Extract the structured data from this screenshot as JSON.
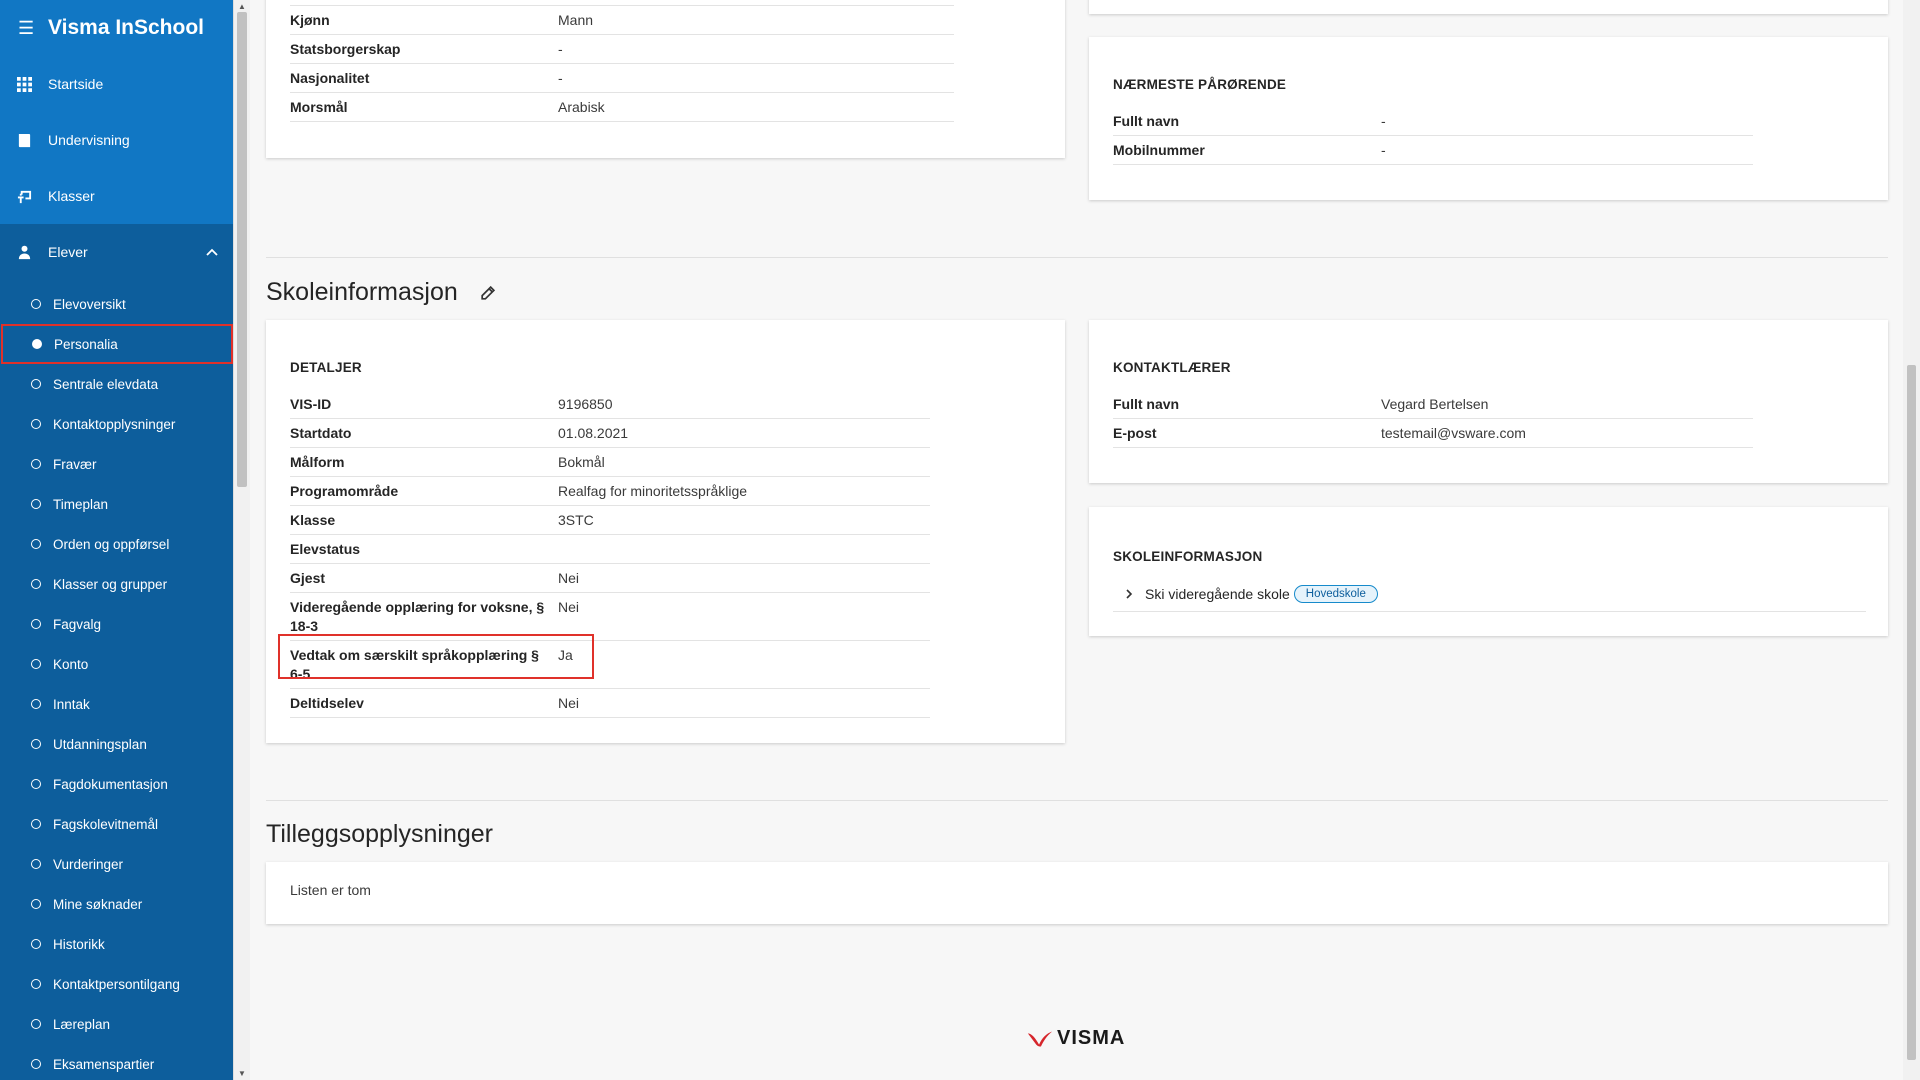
{
  "app": {
    "title": "Visma InSchool",
    "footer_logo": "VISMA"
  },
  "sidebar": {
    "main": [
      {
        "label": "Startside",
        "icon": "grid-icon"
      },
      {
        "label": "Undervisning",
        "icon": "book-icon"
      },
      {
        "label": "Klasser",
        "icon": "classroom-icon"
      },
      {
        "label": "Elever",
        "icon": "student-icon"
      }
    ],
    "sub": [
      "Elevoversikt",
      "Personalia",
      "Sentrale elevdata",
      "Kontaktopplysninger",
      "Fravær",
      "Timeplan",
      "Orden og oppførsel",
      "Klasser og grupper",
      "Fagvalg",
      "Konto",
      "Inntak",
      "Utdanningsplan",
      "Fagdokumentasjon",
      "Fagskolevitnemål",
      "Vurderinger",
      "Mine søknader",
      "Historikk",
      "Kontaktpersontilgang",
      "Læreplan",
      "Eksamenspartier"
    ]
  },
  "personal": {
    "rows": [
      {
        "k": "Kjønn",
        "v": "Mann"
      },
      {
        "k": "Statsborgerskap",
        "v": "-"
      },
      {
        "k": "Nasjonalitet",
        "v": "-"
      },
      {
        "k": "Morsmål",
        "v": "Arabisk"
      }
    ]
  },
  "relative": {
    "title": "NÆRMESTE PÅRØRENDE",
    "rows": [
      {
        "k": "Fullt navn",
        "v": "-"
      },
      {
        "k": "Mobilnummer",
        "v": "-"
      }
    ]
  },
  "school_section": {
    "title": "Skoleinformasjon",
    "details_title": "DETALJER",
    "details": [
      {
        "k": "VIS-ID",
        "v": "9196850"
      },
      {
        "k": "Startdato",
        "v": "01.08.2021"
      },
      {
        "k": "Målform",
        "v": "Bokmål"
      },
      {
        "k": "Programområde",
        "v": "Realfag for minoritetsspråklige"
      },
      {
        "k": "Klasse",
        "v": "3STC"
      },
      {
        "k": "Elevstatus",
        "v": ""
      },
      {
        "k": "Gjest",
        "v": "Nei"
      },
      {
        "k": "Videregående opplæring for voksne, § 18-3",
        "v": "Nei"
      },
      {
        "k": "Vedtak om særskilt språkopplæring § 6-5",
        "v": "Ja"
      },
      {
        "k": "Deltidselev",
        "v": "Nei"
      }
    ],
    "contact_title": "KONTAKTLÆRER",
    "contact": [
      {
        "k": "Fullt navn",
        "v": "Vegard Bertelsen"
      },
      {
        "k": "E-post",
        "v": "testemail@vsware.com"
      }
    ],
    "schoolinfo_title": "SKOLEINFORMASJON",
    "school_name": "Ski videregående skole",
    "school_badge": "Hovedskole"
  },
  "extra": {
    "title": "Tilleggsopplysninger",
    "empty_text": "Listen er tom"
  },
  "colors": {
    "sidebar": "#0d5e9c",
    "sidebar_top": "#1177c4",
    "highlight": "#e0312a",
    "visma_red": "#d6262c"
  }
}
